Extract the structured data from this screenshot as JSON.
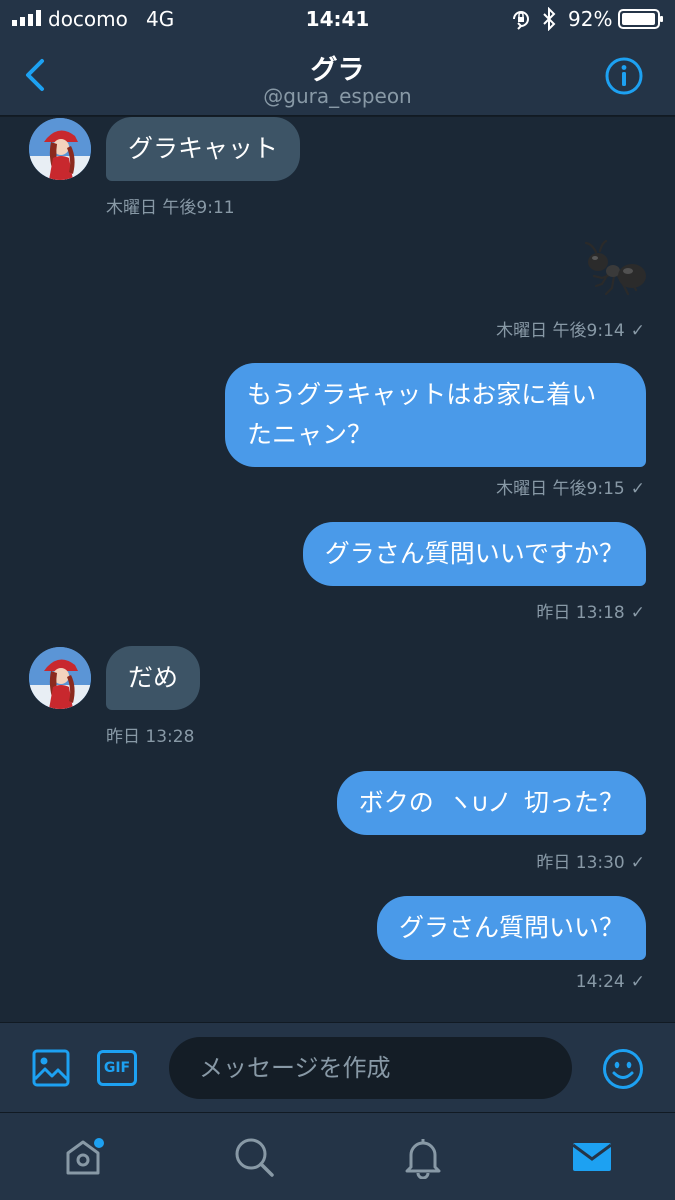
{
  "status_bar": {
    "carrier": "docomo",
    "network": "4G",
    "time": "14:41",
    "battery": "92%",
    "icons": [
      "signal-icon",
      "orientation-lock-icon",
      "bluetooth-icon",
      "battery-icon"
    ]
  },
  "header": {
    "name": "グラ",
    "handle": "@gura_espeon",
    "icons": [
      "back-icon",
      "info-icon"
    ]
  },
  "messages": [
    {
      "direction": "in",
      "text": "グラキャット",
      "meta": "木曜日 午後9:11"
    },
    {
      "direction": "out",
      "emoji": "ant",
      "meta": "木曜日 午後9:14",
      "read": "✓"
    },
    {
      "direction": "out",
      "text_lines": [
        "もうグラキャットはお家に着い",
        "たニャン？"
      ],
      "meta": "木曜日 午後9:15",
      "read": "✓"
    },
    {
      "direction": "out",
      "text": "グラさん質問いいですか？",
      "meta": "昨日 13:18",
      "read": "✓"
    },
    {
      "direction": "in",
      "text": "だめ",
      "meta": "昨日 13:28"
    },
    {
      "direction": "out",
      "text_before": "ボクの",
      "glyph": "ヽ∪ノ",
      "text_after": "切った？",
      "meta": "昨日 13:30",
      "read": "✓"
    },
    {
      "direction": "out",
      "text": "グラさん質問いい？",
      "meta": "14:24",
      "read": "✓"
    }
  ],
  "composer": {
    "gif_label": "GIF",
    "placeholder": "メッセージを作成",
    "icons": [
      "image-icon",
      "emoji-icon"
    ]
  },
  "tabs": [
    {
      "name": "home",
      "icon": "home-icon",
      "notification_dot": true
    },
    {
      "name": "search",
      "icon": "search-icon"
    },
    {
      "name": "notifications",
      "icon": "bell-icon"
    },
    {
      "name": "messages",
      "icon": "mail-icon",
      "active": true
    }
  ],
  "colors": {
    "background": "#141d26",
    "bar": "#243447",
    "incoming_bubble": "#3d5466",
    "outgoing_bubble": "#4a9ae9",
    "accent": "#1da1f2",
    "muted_text": "#8899a6"
  }
}
